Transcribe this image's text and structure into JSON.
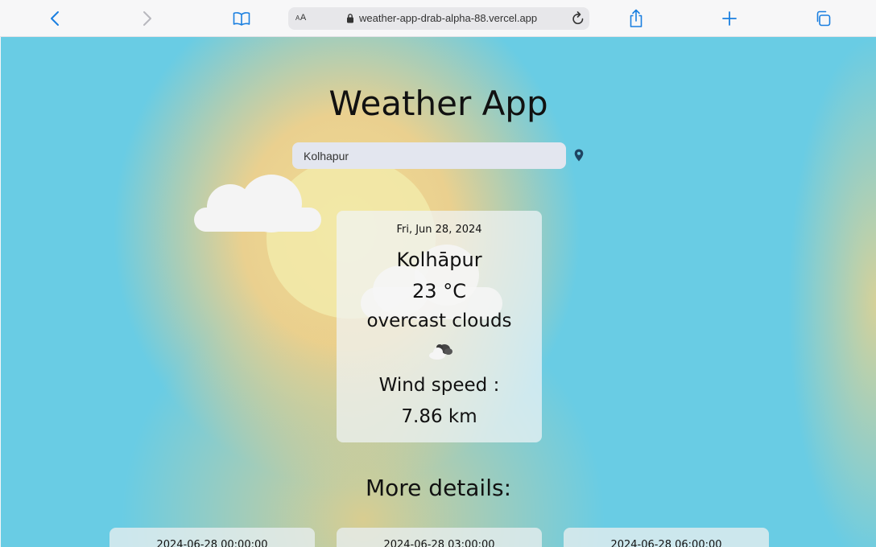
{
  "browser": {
    "text_size_label": "AA",
    "url": "weather-app-drab-alpha-88.vercel.app"
  },
  "app": {
    "title": "Weather App",
    "search_value": "Kolhapur"
  },
  "current": {
    "date": "Fri, Jun 28, 2024",
    "city": "Kolhāpur",
    "temperature": "23 °C",
    "description": "overcast clouds",
    "weather_icon": "overcast-clouds-icon",
    "wind_label": "Wind speed :",
    "wind_value": "7.86 km"
  },
  "more_details": {
    "heading": "More details:",
    "forecasts": [
      {
        "datetime": "2024-06-28 00:00:00"
      },
      {
        "datetime": "2024-06-28 03:00:00"
      },
      {
        "datetime": "2024-06-28 06:00:00"
      }
    ]
  },
  "colors": {
    "accent": "#1a7fe0",
    "sky": "#69cce4",
    "sun_glow": "#ead08f"
  }
}
